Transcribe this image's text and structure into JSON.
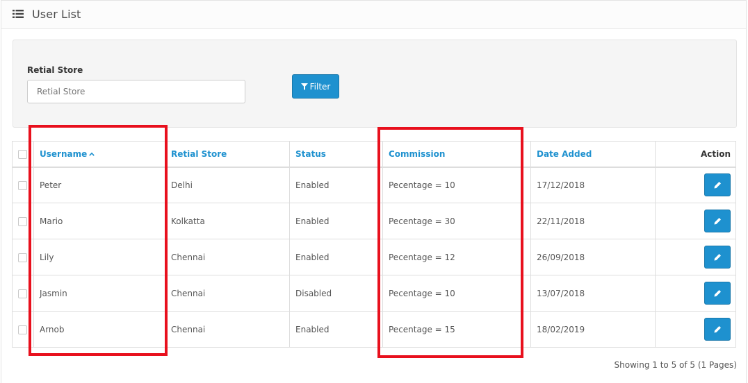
{
  "header": {
    "title": "User List",
    "icon": "list-icon"
  },
  "filter": {
    "label": "Retial Store",
    "placeholder": "Retial Store",
    "button_label": "Filter"
  },
  "table": {
    "columns": [
      "Username",
      "Retial Store",
      "Status",
      "Commission",
      "Date Added",
      "Action"
    ],
    "rows": [
      {
        "username": "Peter",
        "store": "Delhi",
        "status": "Enabled",
        "commission": "Pecentage = 10",
        "date": "17/12/2018"
      },
      {
        "username": "Mario",
        "store": "Kolkatta",
        "status": "Enabled",
        "commission": "Pecentage = 30",
        "date": "22/11/2018"
      },
      {
        "username": "Lily",
        "store": "Chennai",
        "status": "Enabled",
        "commission": "Pecentage = 12",
        "date": "26/09/2018"
      },
      {
        "username": "Jasmin",
        "store": "Chennai",
        "status": "Disabled",
        "commission": "Pecentage = 10",
        "date": "13/07/2018"
      },
      {
        "username": "Arnob",
        "store": "Chennai",
        "status": "Enabled",
        "commission": "Pecentage = 15",
        "date": "18/02/2019"
      }
    ]
  },
  "pagination": {
    "summary": "Showing 1 to 5 of 5 (1 Pages)"
  },
  "colors": {
    "primary": "#1e91cf",
    "highlight": "#e8101d"
  }
}
